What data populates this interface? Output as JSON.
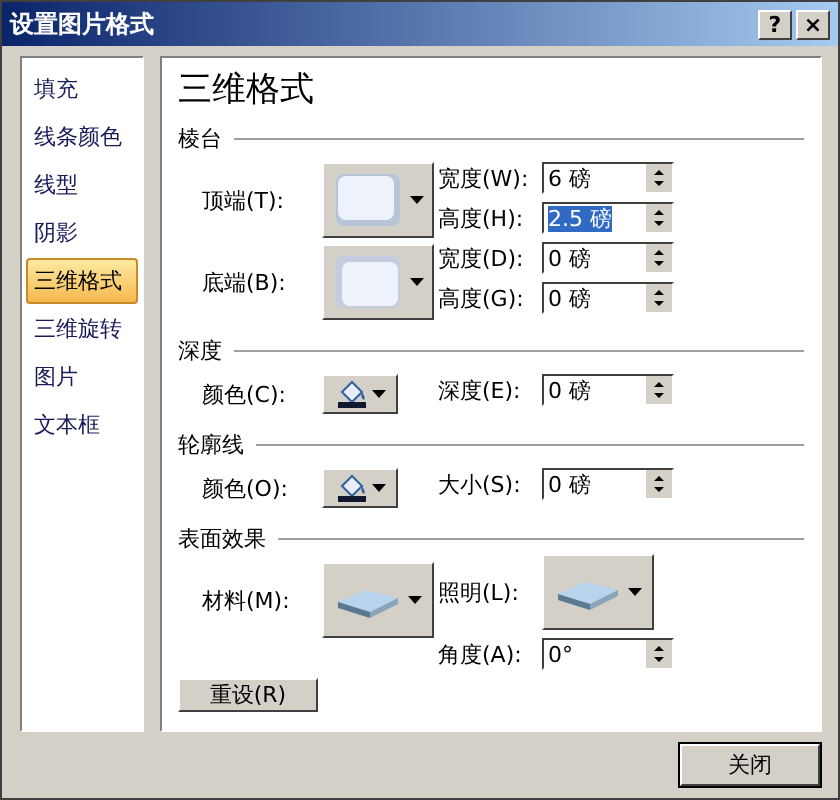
{
  "window": {
    "title": "设置图片格式",
    "help_button": "?",
    "close_button": "×"
  },
  "sidebar": {
    "items": [
      {
        "label": "填充",
        "selected": false
      },
      {
        "label": "线条颜色",
        "selected": false
      },
      {
        "label": "线型",
        "selected": false
      },
      {
        "label": "阴影",
        "selected": false
      },
      {
        "label": "三维格式",
        "selected": true
      },
      {
        "label": "三维旋转",
        "selected": false
      },
      {
        "label": "图片",
        "selected": false
      },
      {
        "label": "文本框",
        "selected": false
      }
    ]
  },
  "panel": {
    "title": "三维格式",
    "sections": [
      {
        "heading": "棱台",
        "left": [
          {
            "kind": "bevel-top",
            "label": "顶端(T):"
          },
          {
            "kind": "bevel-bottom",
            "label": "底端(B):"
          }
        ],
        "right": [
          {
            "kind": "spin",
            "label": "宽度(W):",
            "value": "6 磅",
            "selected": false
          },
          {
            "kind": "spin",
            "label": "高度(H):",
            "value": "2.5 磅",
            "selected": true
          },
          {
            "kind": "spin",
            "label": "宽度(D):",
            "value": "0 磅",
            "selected": false
          },
          {
            "kind": "spin",
            "label": "高度(G):",
            "value": "0 磅",
            "selected": false
          }
        ]
      },
      {
        "heading": "深度",
        "left": [
          {
            "kind": "color",
            "label": "颜色(C):"
          }
        ],
        "right": [
          {
            "kind": "spin",
            "label": "深度(E):",
            "value": "0 磅",
            "selected": false
          }
        ]
      },
      {
        "heading": "轮廓线",
        "left": [
          {
            "kind": "color",
            "label": "颜色(O):"
          }
        ],
        "right": [
          {
            "kind": "spin",
            "label": "大小(S):",
            "value": "0 磅",
            "selected": false
          }
        ]
      },
      {
        "heading": "表面效果",
        "left": [
          {
            "kind": "material",
            "label": "材料(M):"
          }
        ],
        "right": [
          {
            "kind": "lighting",
            "label": "照明(L):"
          },
          {
            "kind": "spin",
            "label": "角度(A):",
            "value": "0°",
            "selected": false
          }
        ]
      }
    ],
    "reset_button": "重设(R)"
  },
  "footer": {
    "close_button": "关闭"
  }
}
